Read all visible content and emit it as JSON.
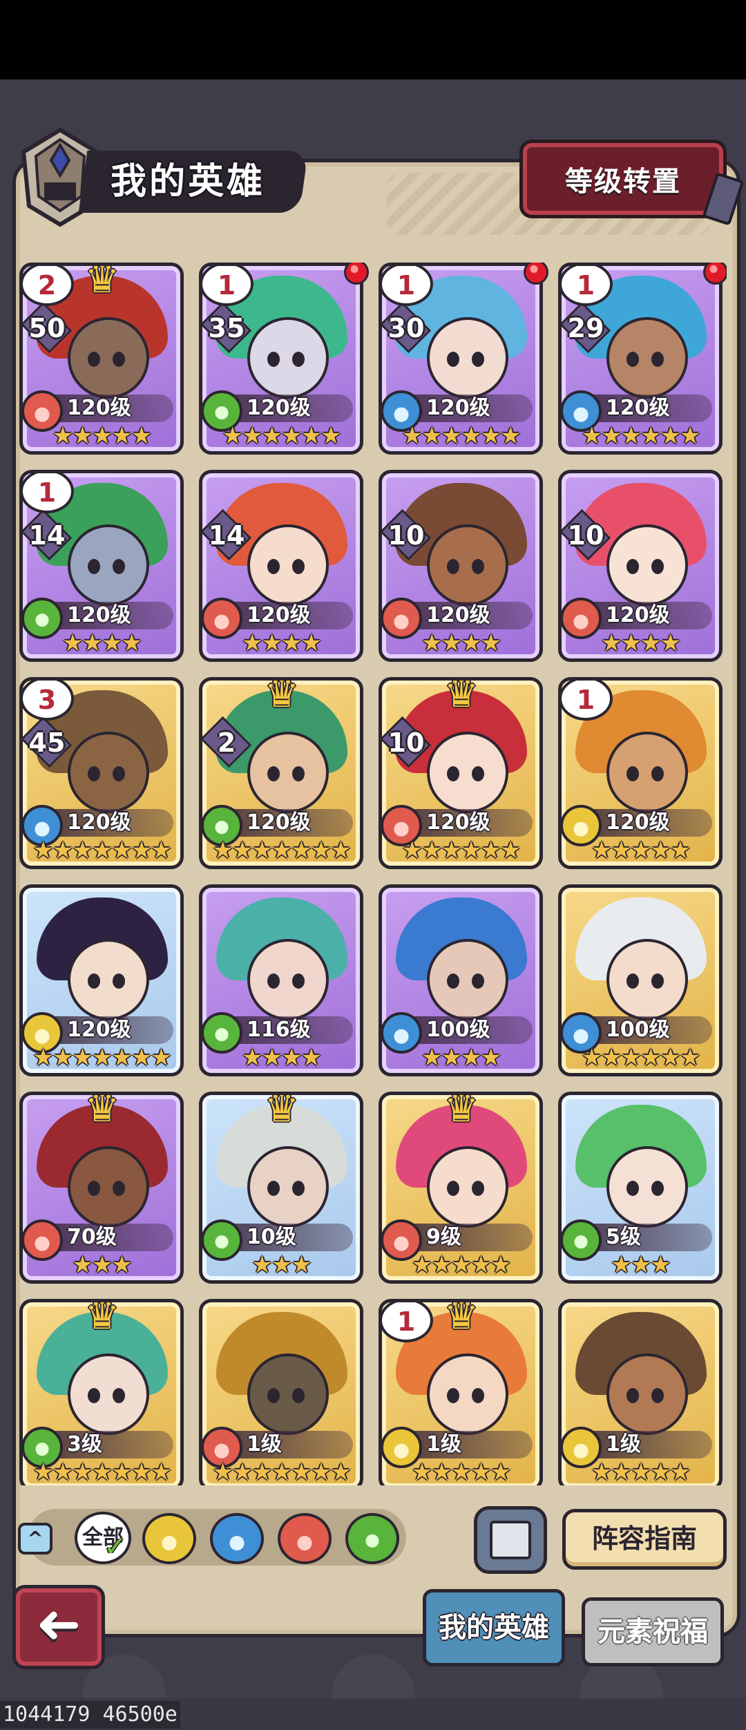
{
  "header": {
    "title": "我的英雄",
    "reset_button": "等级转置"
  },
  "colors": {
    "fire": "#e05a4e",
    "water": "#3f8fd6",
    "nature": "#58b43a",
    "earth": "#e9c53a",
    "purple_frame": "#9f6fd8",
    "gold_frame": "#e2b348",
    "blue_frame": "#a9c9ec"
  },
  "heroes": [
    {
      "rank": "2",
      "count": "50",
      "crown": true,
      "red_dot": false,
      "element": "fire",
      "level": "120级",
      "stars": "★★★★★",
      "frame": "purple",
      "hair": "#b9352c",
      "skin": "#8a6b5a"
    },
    {
      "rank": "1",
      "count": "35",
      "crown": false,
      "red_dot": true,
      "element": "nature",
      "level": "120级",
      "stars": "★★★★★★",
      "frame": "purple",
      "hair": "#3db88c",
      "skin": "#dcd8e8"
    },
    {
      "rank": "1",
      "count": "30",
      "crown": false,
      "red_dot": true,
      "element": "water",
      "level": "120级",
      "stars": "★★★★★★",
      "frame": "purple",
      "hair": "#5fb4e0",
      "skin": "#f2dcd2"
    },
    {
      "rank": "1",
      "count": "29",
      "crown": false,
      "red_dot": true,
      "element": "water",
      "level": "120级",
      "stars": "★★★★★★",
      "frame": "purple",
      "hair": "#3fa7d8",
      "skin": "#b68466"
    },
    {
      "rank": "1",
      "count": "14",
      "crown": false,
      "red_dot": false,
      "element": "nature",
      "level": "120级",
      "stars": "★★★★",
      "frame": "purple",
      "hair": "#3aa05a",
      "skin": "#9aa6c0"
    },
    {
      "rank": "",
      "count": "14",
      "crown": false,
      "red_dot": false,
      "element": "fire",
      "level": "120级",
      "stars": "★★★★",
      "frame": "purple",
      "hair": "#e25a3c",
      "skin": "#f6dccc"
    },
    {
      "rank": "",
      "count": "10",
      "crown": false,
      "red_dot": false,
      "element": "fire",
      "level": "120级",
      "stars": "★★★★",
      "frame": "purple",
      "hair": "#7a4a34",
      "skin": "#a86e4c"
    },
    {
      "rank": "",
      "count": "10",
      "crown": false,
      "red_dot": false,
      "element": "fire",
      "level": "120级",
      "stars": "★★★★",
      "frame": "purple",
      "hair": "#e8506a",
      "skin": "#f8e2d6"
    },
    {
      "rank": "3",
      "count": "45",
      "crown": false,
      "red_dot": false,
      "element": "water",
      "level": "120级",
      "stars": "★★★★★★★",
      "frame": "gold",
      "hair": "#7a5a3a",
      "skin": "#8b6444"
    },
    {
      "rank": "",
      "count": "2",
      "crown": true,
      "red_dot": false,
      "element": "nature",
      "level": "120级",
      "stars": "★★★★★★★",
      "frame": "gold",
      "hair": "#3c9a6a",
      "skin": "#e6c2a0"
    },
    {
      "rank": "",
      "count": "10",
      "crown": true,
      "red_dot": false,
      "element": "fire",
      "level": "120级",
      "stars": "★★★★★★",
      "frame": "gold",
      "hair": "#c92f3a",
      "skin": "#f6ddd0"
    },
    {
      "rank": "1",
      "count": "",
      "crown": false,
      "red_dot": false,
      "element": "earth",
      "level": "120级",
      "stars": "★★★★★",
      "frame": "gold",
      "hair": "#e08a32",
      "skin": "#d6a070"
    },
    {
      "rank": "",
      "count": "",
      "crown": false,
      "red_dot": false,
      "element": "earth",
      "level": "120级",
      "stars": "★★★★★★★",
      "frame": "blue",
      "hair": "#2e2244",
      "skin": "#f2dccc"
    },
    {
      "rank": "",
      "count": "",
      "crown": false,
      "red_dot": false,
      "element": "nature",
      "level": "116级",
      "stars": "★★★★",
      "frame": "purple",
      "hair": "#4ab0a8",
      "skin": "#f0d6cc"
    },
    {
      "rank": "",
      "count": "",
      "crown": false,
      "red_dot": false,
      "element": "water",
      "level": "100级",
      "stars": "★★★★",
      "frame": "purple",
      "hair": "#3a7ad0",
      "skin": "#e6c8b8"
    },
    {
      "rank": "",
      "count": "",
      "crown": false,
      "red_dot": false,
      "element": "water",
      "level": "100级",
      "stars": "★★★★★★",
      "frame": "gold",
      "hair": "#e8ecef",
      "skin": "#f3dccb"
    },
    {
      "rank": "",
      "count": "",
      "crown": true,
      "red_dot": false,
      "element": "fire",
      "level": "70级",
      "stars": "★★★",
      "frame": "purple",
      "hair": "#9a2a30",
      "skin": "#8a5840"
    },
    {
      "rank": "",
      "count": "",
      "crown": true,
      "red_dot": false,
      "element": "nature",
      "level": "10级",
      "stars": "★★★",
      "frame": "blue",
      "hair": "#d8dcd8",
      "skin": "#e8d2c6"
    },
    {
      "rank": "",
      "count": "",
      "crown": true,
      "red_dot": false,
      "element": "fire",
      "level": "9级",
      "stars": "★★★★★",
      "frame": "gold",
      "hair": "#e04a7a",
      "skin": "#f6dccc"
    },
    {
      "rank": "",
      "count": "",
      "crown": false,
      "red_dot": false,
      "element": "nature",
      "level": "5级",
      "stars": "★★★",
      "frame": "blue",
      "hair": "#58c06a",
      "skin": "#f4e0d4"
    },
    {
      "rank": "",
      "count": "",
      "crown": true,
      "red_dot": false,
      "element": "nature",
      "level": "3级",
      "stars": "★★★★★★★",
      "frame": "gold",
      "hair": "#4ab098",
      "skin": "#f2ddd2"
    },
    {
      "rank": "",
      "count": "",
      "crown": false,
      "red_dot": false,
      "element": "fire",
      "level": "1级",
      "stars": "★★★★★★★",
      "frame": "gold",
      "hair": "#c08a2a",
      "skin": "#6a5a48"
    },
    {
      "rank": "1",
      "count": "",
      "crown": true,
      "red_dot": false,
      "element": "earth",
      "level": "1级",
      "stars": "★★★★★",
      "frame": "gold",
      "hair": "#e87a3a",
      "skin": "#f4d8c4"
    },
    {
      "rank": "",
      "count": "",
      "crown": false,
      "red_dot": false,
      "element": "earth",
      "level": "1级",
      "stars": "★★★★★",
      "frame": "gold",
      "hair": "#6a4a32",
      "skin": "#b27a54"
    }
  ],
  "filters": {
    "collapse_icon": "^",
    "all_label": "全部",
    "check": "✓",
    "elements": [
      "earth",
      "water",
      "fire",
      "nature"
    ]
  },
  "buttons": {
    "lineup_guide": "阵容指南",
    "back_icon": "➜"
  },
  "tabs": {
    "my_heroes": "我的英雄",
    "element_blessing": "元素祝福"
  },
  "debug_text": "1044179 46500e"
}
